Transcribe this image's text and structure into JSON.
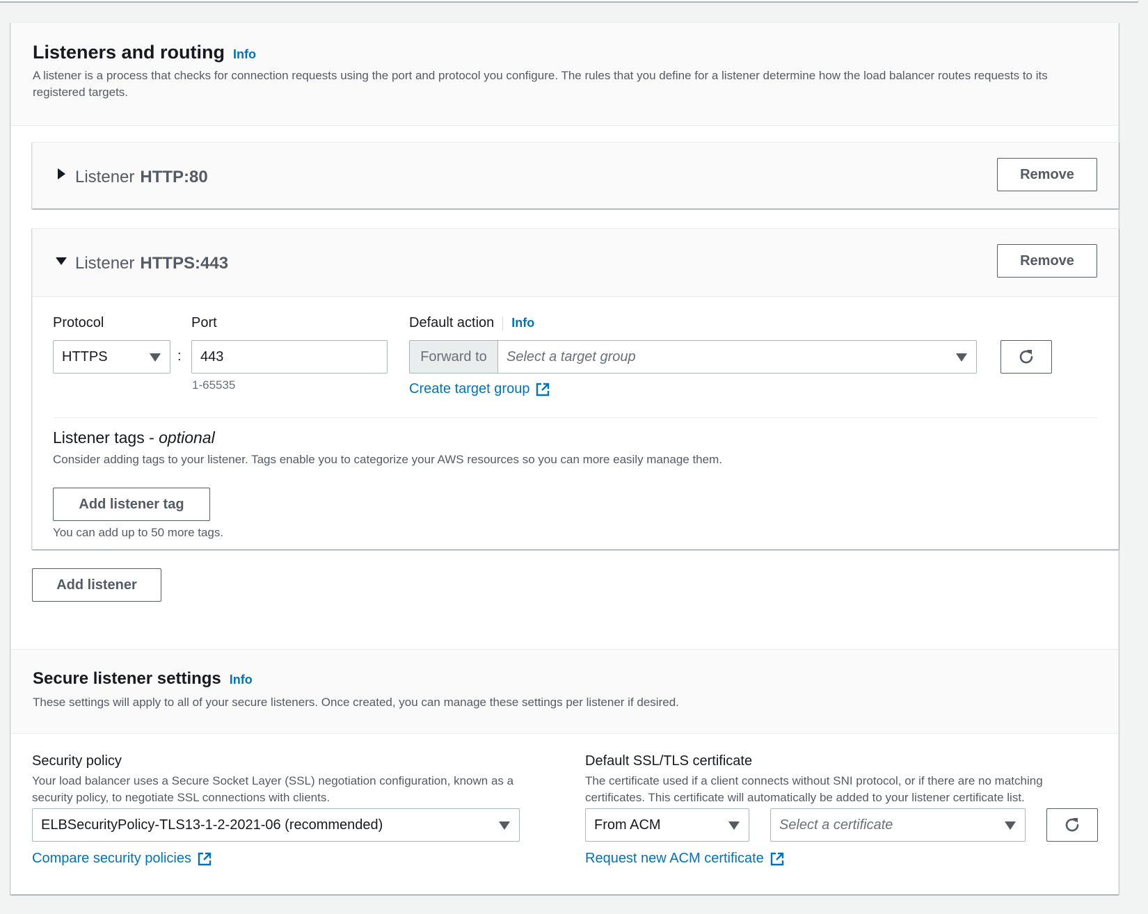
{
  "listeners_section": {
    "title": "Listeners and routing",
    "info": "Info",
    "description": "A listener is a process that checks for connection requests using the port and protocol you configure. The rules that you define for a listener determine how the load balancer routes requests to its registered targets."
  },
  "listener_http": {
    "prefix": "Listener",
    "name": "HTTP:80",
    "remove": "Remove"
  },
  "listener_https": {
    "prefix": "Listener",
    "name": "HTTPS:443",
    "remove": "Remove",
    "protocol_label": "Protocol",
    "protocol_value": "HTTPS",
    "separator": ":",
    "port_label": "Port",
    "port_value": "443",
    "port_hint": "1-65535",
    "default_action_label": "Default action",
    "default_action_info": "Info",
    "forward_to": "Forward to",
    "target_group_placeholder": "Select a target group",
    "create_target_group": "Create target group",
    "tags_title": "Listener tags - ",
    "tags_optional": "optional",
    "tags_description": "Consider adding tags to your listener. Tags enable you to categorize your AWS resources so you can more easily manage them.",
    "add_tag": "Add listener tag",
    "tags_hint": "You can add up to 50 more tags."
  },
  "add_listener": "Add listener",
  "secure_section": {
    "title": "Secure listener settings",
    "info": "Info",
    "description": "These settings will apply to all of your secure listeners. Once created, you can manage these settings per listener if desired.",
    "policy_label": "Security policy",
    "policy_description": "Your load balancer uses a Secure Socket Layer (SSL) negotiation configuration, known as a security policy, to negotiate SSL connections with clients.",
    "policy_value": "ELBSecurityPolicy-TLS13-1-2-2021-06 (recommended)",
    "compare_link": "Compare security policies",
    "cert_label": "Default SSL/TLS certificate",
    "cert_description": "The certificate used if a client connects without SNI protocol, or if there are no matching certificates. This certificate will automatically be added to your listener certificate list.",
    "cert_source": "From ACM",
    "cert_placeholder": "Select a certificate",
    "request_link": "Request new ACM certificate"
  },
  "colors": {
    "link": "#0073bb",
    "text": "#16191f",
    "secondary_text": "#545b64",
    "border": "#aab7b8"
  }
}
